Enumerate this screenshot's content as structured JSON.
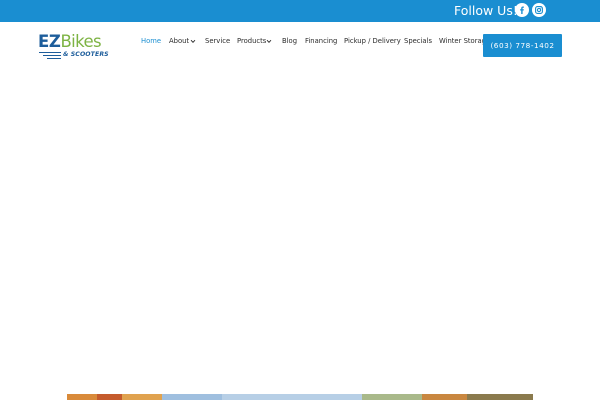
{
  "topbar": {
    "follow_label": "Follow Us!",
    "social": [
      {
        "name": "facebook",
        "icon": "facebook-icon"
      },
      {
        "name": "instagram",
        "icon": "instagram-icon"
      }
    ],
    "background_color": "#1a8ed1"
  },
  "logo": {
    "ez": "EZ",
    "bikes": "Bikes",
    "tagline": "& SCOOTERS",
    "colors": {
      "ez": "#1d5d9b",
      "bikes": "#7db343"
    }
  },
  "nav": {
    "items": [
      {
        "label": "Home",
        "active": true,
        "dropdown": false
      },
      {
        "label": "About",
        "active": false,
        "dropdown": true
      },
      {
        "label": "Service",
        "active": false,
        "dropdown": false
      },
      {
        "label": "Products",
        "active": false,
        "dropdown": true
      },
      {
        "label": "Blog",
        "active": false,
        "dropdown": false
      },
      {
        "label": "Financing",
        "active": false,
        "dropdown": false
      },
      {
        "label": "Pickup / Delivery",
        "active": false,
        "dropdown": false
      },
      {
        "label": "Specials",
        "active": false,
        "dropdown": false
      },
      {
        "label": "Winter Storage",
        "active": false,
        "dropdown": false
      }
    ],
    "active_color": "#1a8ed1"
  },
  "phone_button": {
    "label": "(603) 778-1402",
    "color": "#1a8ed1"
  }
}
